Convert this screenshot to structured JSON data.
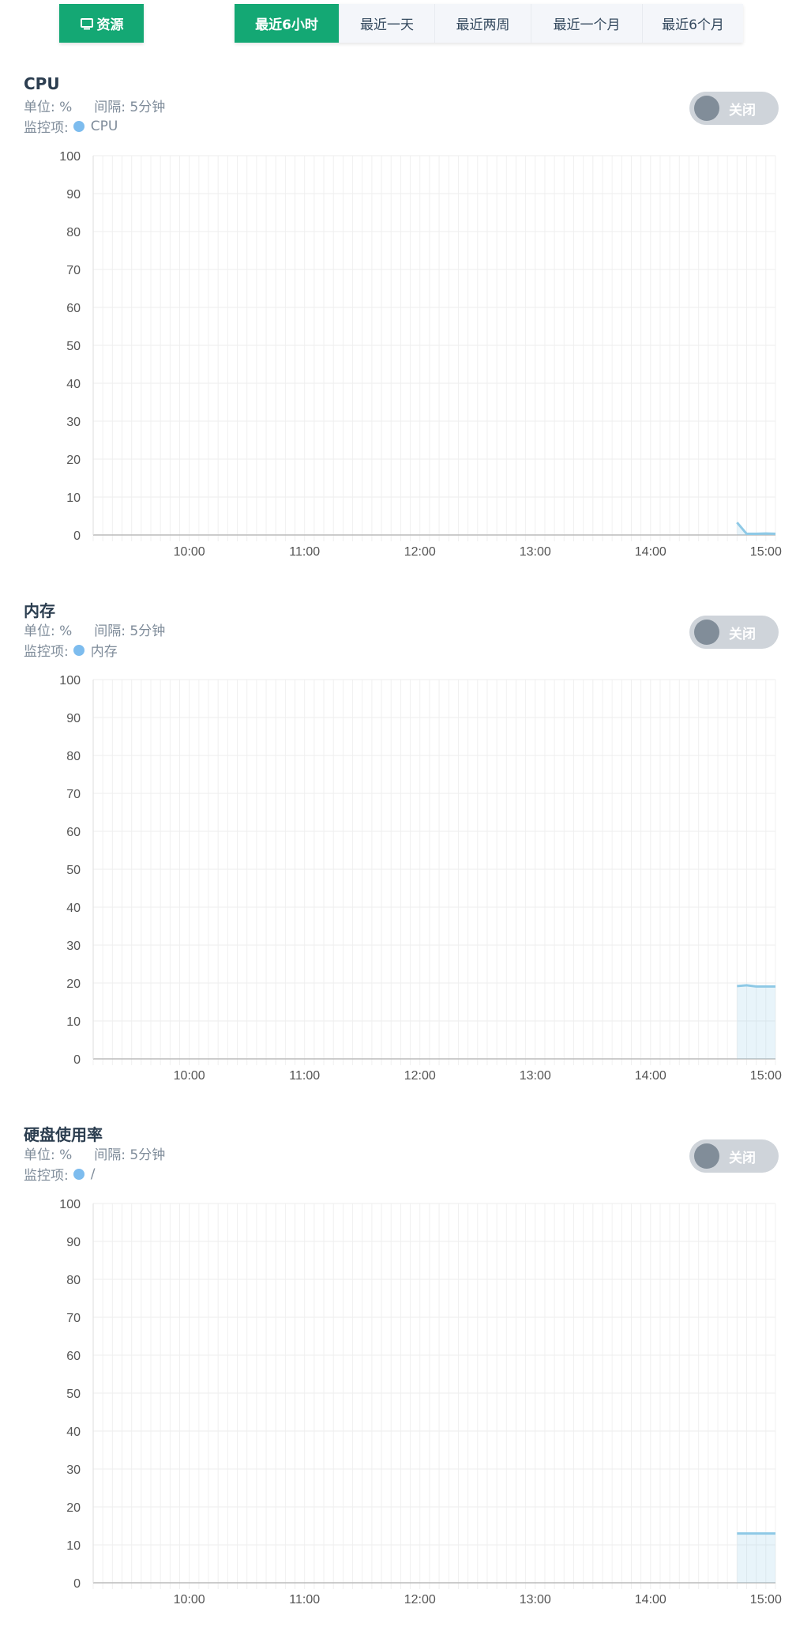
{
  "resource_button": {
    "label": "资源",
    "icon": "monitor-icon"
  },
  "tabs": [
    {
      "label": "最近6小时",
      "active": true
    },
    {
      "label": "最近一天"
    },
    {
      "label": "最近两周"
    },
    {
      "label": "最近一个月"
    },
    {
      "label": "最近6个月"
    }
  ],
  "sections": [
    {
      "title": "CPU",
      "unit": "单位: %",
      "interval": "间隔: 5分钟",
      "legend_prefix": "监控项:",
      "legend": "CPU",
      "toggle": "关闭"
    },
    {
      "title": "内存",
      "unit": "单位: %",
      "interval": "间隔: 5分钟",
      "legend_prefix": "监控项:",
      "legend": "内存",
      "toggle": "关闭"
    },
    {
      "title": "硬盘使用率",
      "unit": "单位: %",
      "interval": "间隔: 5分钟",
      "legend_prefix": "监控项:",
      "legend": "/",
      "toggle": "关闭"
    }
  ],
  "colors": {
    "accent": "#14a874",
    "series": "#8ec9e6"
  },
  "chart_data": [
    {
      "type": "area",
      "title": "CPU",
      "ylim": [
        0,
        100
      ],
      "yticks": [
        0,
        10,
        20,
        30,
        40,
        50,
        60,
        70,
        80,
        90,
        100
      ],
      "xticks": [
        "10:00",
        "11:00",
        "12:00",
        "13:00",
        "14:00",
        "15:00"
      ],
      "xrange_minutes": [
        550,
        905
      ],
      "x_minutes": [
        885,
        890,
        895,
        900,
        905
      ],
      "values": [
        3.3,
        0.3,
        0.3,
        0.4,
        0.3
      ]
    },
    {
      "type": "area",
      "title": "内存",
      "ylim": [
        0,
        100
      ],
      "yticks": [
        0,
        10,
        20,
        30,
        40,
        50,
        60,
        70,
        80,
        90,
        100
      ],
      "xticks": [
        "10:00",
        "11:00",
        "12:00",
        "13:00",
        "14:00",
        "15:00"
      ],
      "xrange_minutes": [
        550,
        905
      ],
      "x_minutes": [
        885,
        890,
        895,
        900,
        905
      ],
      "values": [
        19.2,
        19.4,
        19.1,
        19.1,
        19.1
      ]
    },
    {
      "type": "area",
      "title": "硬盘使用率",
      "ylim": [
        0,
        100
      ],
      "yticks": [
        0,
        10,
        20,
        30,
        40,
        50,
        60,
        70,
        80,
        90,
        100
      ],
      "xticks": [
        "10:00",
        "11:00",
        "12:00",
        "13:00",
        "14:00",
        "15:00"
      ],
      "xrange_minutes": [
        550,
        905
      ],
      "x_minutes": [
        885,
        890,
        895,
        900,
        905
      ],
      "values": [
        13,
        13,
        13,
        13,
        13
      ]
    }
  ]
}
